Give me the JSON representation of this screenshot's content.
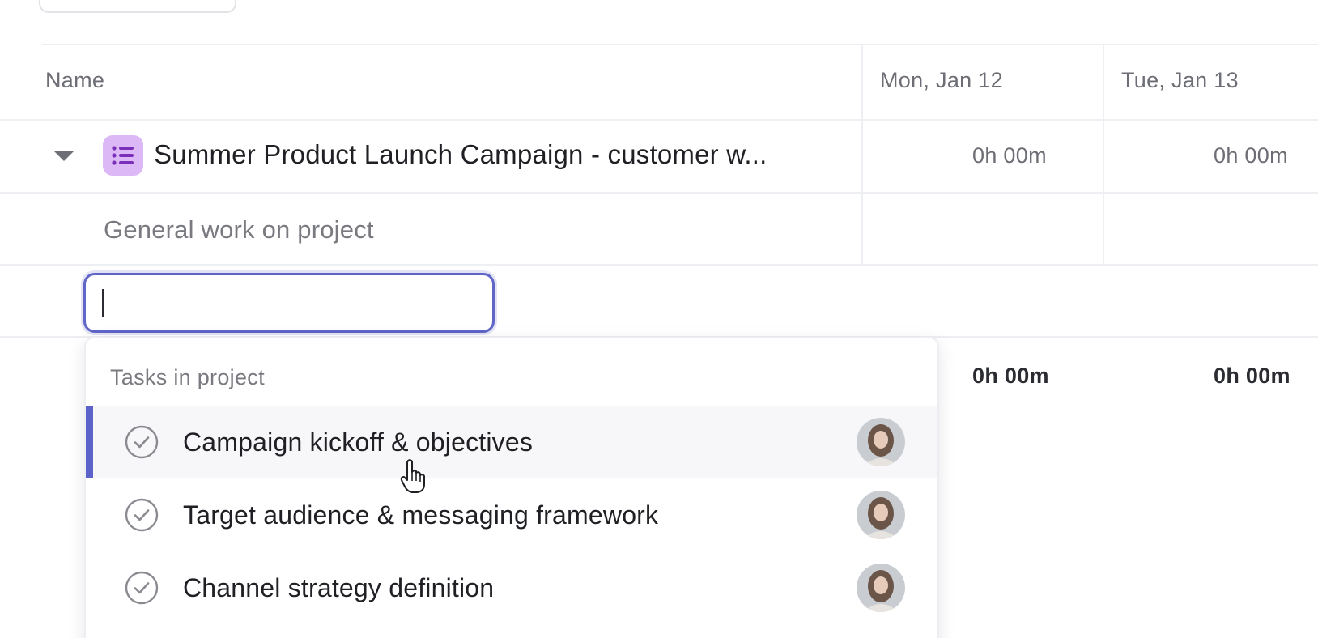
{
  "table": {
    "columns": {
      "name": "Name",
      "days": [
        "Mon, Jan 12",
        "Tue, Jan 13"
      ]
    },
    "project": {
      "title": "Summer Product Launch Campaign - customer w...",
      "icon": "list-icon",
      "icon_color": "#dcb8f6",
      "times": [
        "0h 00m",
        "0h 00m"
      ]
    },
    "general_row": {
      "label": "General work on project"
    },
    "totals": [
      "0h 00m",
      "0h 00m"
    ]
  },
  "task_search": {
    "value": "",
    "placeholder": ""
  },
  "dropdown": {
    "heading": "Tasks in project",
    "items": [
      {
        "label": "Campaign kickoff & objectives",
        "status_icon": "check-circle-icon",
        "avatar": "assignee-avatar",
        "active": true
      },
      {
        "label": "Target audience & messaging framework",
        "status_icon": "check-circle-icon",
        "avatar": "assignee-avatar",
        "active": false
      },
      {
        "label": "Channel strategy definition",
        "status_icon": "check-circle-icon",
        "avatar": "assignee-avatar",
        "active": false
      }
    ]
  },
  "colors": {
    "accent": "#5b63c9",
    "input_border": "#6065c6",
    "muted_text": "#6d6e75"
  }
}
